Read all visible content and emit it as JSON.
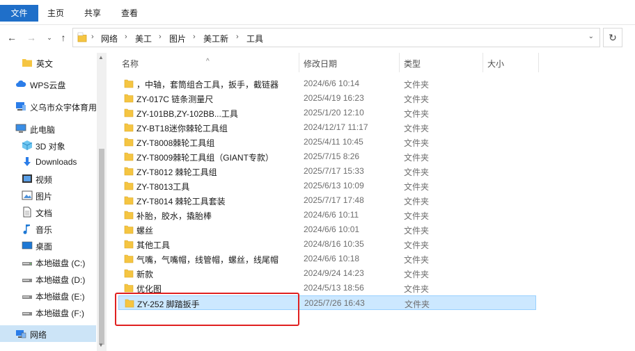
{
  "ribbon": {
    "tabs": [
      {
        "label": "文件"
      },
      {
        "label": "主页"
      },
      {
        "label": "共享"
      },
      {
        "label": "查看"
      }
    ]
  },
  "address": {
    "segments": [
      "网络",
      "美工",
      "图片",
      "美工新",
      "工具"
    ]
  },
  "sidebar": {
    "items": [
      {
        "label": "英文",
        "icon": "folder-icon"
      },
      {
        "label": "WPS云盘",
        "icon": "cloud-icon"
      },
      {
        "label": "义乌市众宇体育用",
        "icon": "network-drive-icon"
      },
      {
        "label": "此电脑",
        "icon": "computer-icon"
      },
      {
        "label": "3D 对象",
        "icon": "cube-icon"
      },
      {
        "label": "Downloads",
        "icon": "download-icon"
      },
      {
        "label": "视频",
        "icon": "video-icon"
      },
      {
        "label": "图片",
        "icon": "picture-icon"
      },
      {
        "label": "文档",
        "icon": "document-icon"
      },
      {
        "label": "音乐",
        "icon": "music-icon"
      },
      {
        "label": "桌面",
        "icon": "desktop-icon"
      },
      {
        "label": "本地磁盘 (C:)",
        "icon": "drive-icon"
      },
      {
        "label": "本地磁盘 (D:)",
        "icon": "drive-icon"
      },
      {
        "label": "本地磁盘 (E:)",
        "icon": "drive-icon"
      },
      {
        "label": "本地磁盘 (F:)",
        "icon": "drive-icon"
      },
      {
        "label": "网络",
        "icon": "network-icon",
        "selected": true
      }
    ]
  },
  "columns": {
    "name": "名称",
    "modified": "修改日期",
    "type": "类型",
    "size": "大小"
  },
  "files": [
    {
      "name": "，中轴，套筒组合工具，扳手，截链器",
      "modified": "2024/6/6 10:14",
      "type": "文件夹"
    },
    {
      "name": "ZY-017C  链条测量尺",
      "modified": "2025/4/19 16:23",
      "type": "文件夹"
    },
    {
      "name": "ZY-101BB,ZY-102BB...工具",
      "modified": "2025/1/20 12:10",
      "type": "文件夹"
    },
    {
      "name": "ZY-BT18迷你棘轮工具组",
      "modified": "2024/12/17 11:17",
      "type": "文件夹"
    },
    {
      "name": "ZY-T8008棘轮工具组",
      "modified": "2025/4/11 10:45",
      "type": "文件夹"
    },
    {
      "name": "ZY-T8009棘轮工具组（GIANT专款）",
      "modified": "2025/7/15 8:26",
      "type": "文件夹"
    },
    {
      "name": "ZY-T8012 棘轮工具组",
      "modified": "2025/7/17 15:33",
      "type": "文件夹"
    },
    {
      "name": "ZY-T8013工具",
      "modified": "2025/6/13 10:09",
      "type": "文件夹"
    },
    {
      "name": "ZY-T8014 棘轮工具套装",
      "modified": "2025/7/17 17:48",
      "type": "文件夹"
    },
    {
      "name": "补胎，胶水，撬胎棒",
      "modified": "2024/6/6 10:11",
      "type": "文件夹"
    },
    {
      "name": "螺丝",
      "modified": "2024/6/6 10:01",
      "type": "文件夹"
    },
    {
      "name": "其他工具",
      "modified": "2024/8/16 10:35",
      "type": "文件夹"
    },
    {
      "name": "气嘴，气嘴帽，线管帽，螺丝，线尾帽",
      "modified": "2024/6/6 10:18",
      "type": "文件夹"
    },
    {
      "name": "新款",
      "modified": "2024/9/24 14:23",
      "type": "文件夹"
    },
    {
      "name": "优化图",
      "modified": "2024/5/13 18:56",
      "type": "文件夹"
    },
    {
      "name": "ZY-252 脚踏扳手",
      "modified": "2025/7/26 16:43",
      "type": "文件夹",
      "selected": true
    }
  ],
  "colors": {
    "accent": "#1f6fc9",
    "selection": "#cce8ff",
    "highlight": "#e02020",
    "folder": "#f5c542"
  }
}
